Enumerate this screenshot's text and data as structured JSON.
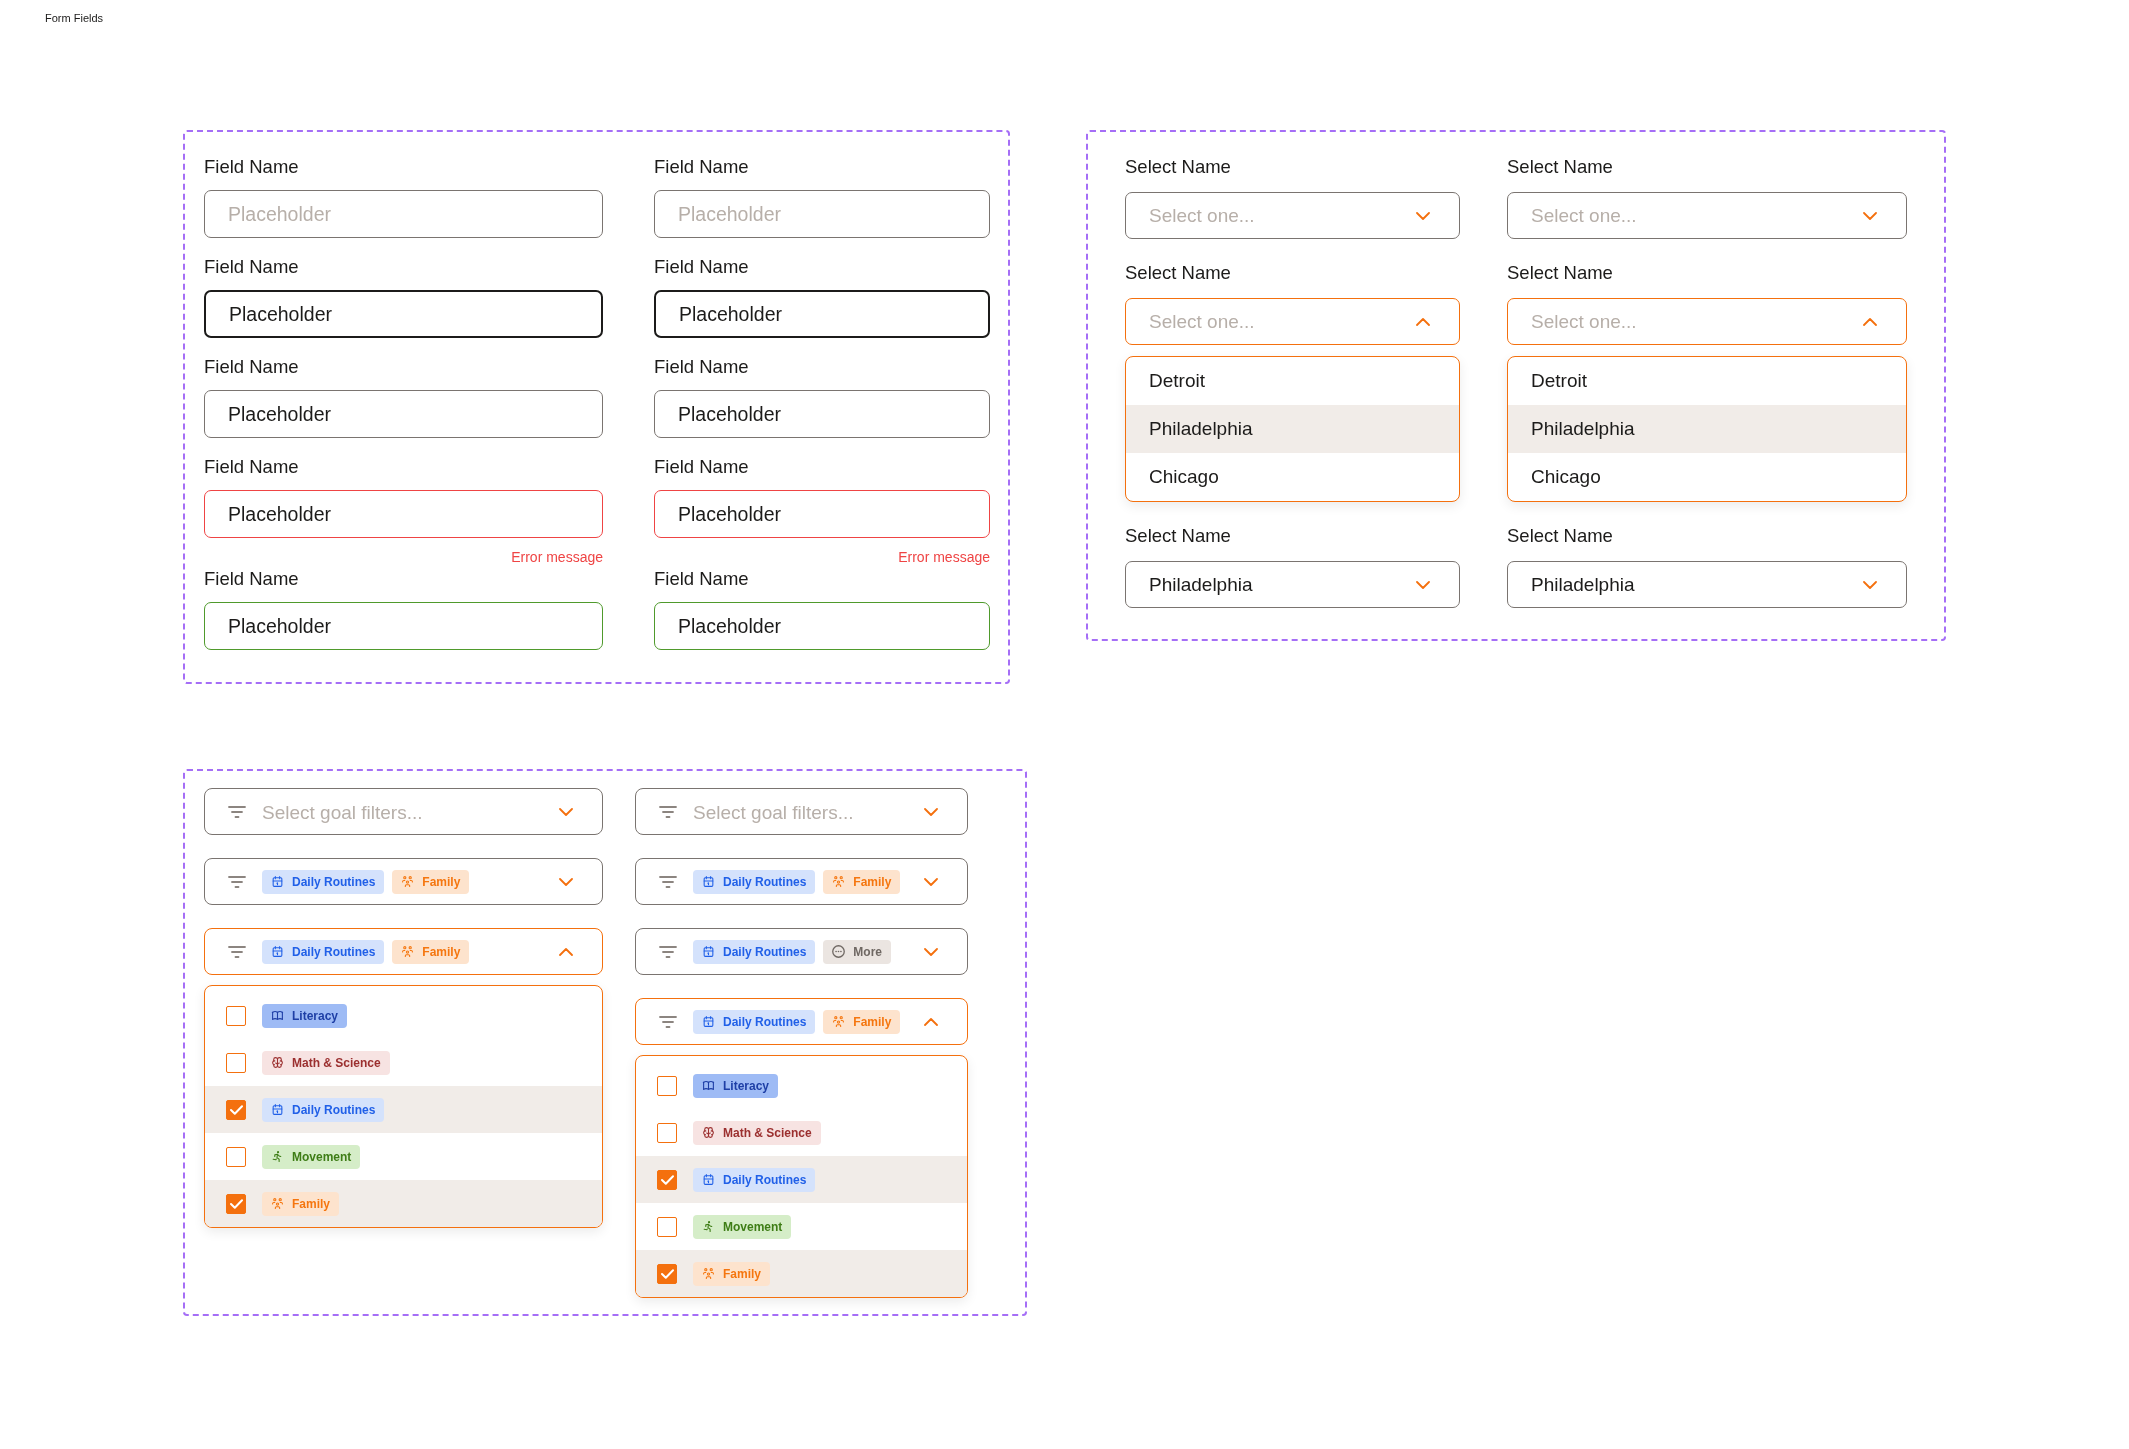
{
  "title": "Form Fields",
  "text_fields": {
    "columns": [
      {
        "fields": [
          {
            "label": "Field Name",
            "placeholder": "Placeholder",
            "focused": false,
            "invalid": false,
            "valid": false
          },
          {
            "label": "Field Name",
            "value": "Placeholder",
            "focused": true,
            "invalid": false,
            "valid": false
          },
          {
            "label": "Field Name",
            "value": "Placeholder",
            "focused": false,
            "invalid": false,
            "valid": false
          },
          {
            "label": "Field Name",
            "value": "Placeholder",
            "focused": false,
            "invalid": true,
            "valid": false,
            "error": "Error message"
          },
          {
            "label": "Field Name",
            "value": "Placeholder",
            "focused": false,
            "invalid": false,
            "valid": true
          }
        ]
      },
      {
        "fields": [
          {
            "label": "Field Name",
            "placeholder": "Placeholder",
            "focused": false,
            "invalid": false,
            "valid": false
          },
          {
            "label": "Field Name",
            "value": "Placeholder",
            "focused": true,
            "invalid": false,
            "valid": false
          },
          {
            "label": "Field Name",
            "value": "Placeholder",
            "focused": false,
            "invalid": false,
            "valid": false
          },
          {
            "label": "Field Name",
            "value": "Placeholder",
            "focused": false,
            "invalid": true,
            "valid": false,
            "error": "Error message"
          },
          {
            "label": "Field Name",
            "value": "Placeholder",
            "focused": false,
            "invalid": false,
            "valid": true
          }
        ]
      }
    ]
  },
  "selects": {
    "columns": [
      {
        "selects": [
          {
            "label": "Select Name",
            "placeholder": "Select one...",
            "expanded": false
          },
          {
            "label": "Select Name",
            "placeholder": "Select one...",
            "expanded": true,
            "options": [
              {
                "label": "Detroit",
                "selected": false
              },
              {
                "label": "Philadelphia",
                "selected": true
              },
              {
                "label": "Chicago",
                "selected": false
              }
            ]
          },
          {
            "label": "Select Name",
            "value": "Philadelphia",
            "expanded": false
          }
        ]
      },
      {
        "selects": [
          {
            "label": "Select Name",
            "placeholder": "Select one...",
            "expanded": false
          },
          {
            "label": "Select Name",
            "placeholder": "Select one...",
            "expanded": true,
            "options": [
              {
                "label": "Detroit",
                "selected": false
              },
              {
                "label": "Philadelphia",
                "selected": true
              },
              {
                "label": "Chicago",
                "selected": false
              }
            ]
          },
          {
            "label": "Select Name",
            "value": "Philadelphia",
            "expanded": false
          }
        ]
      }
    ]
  },
  "goal_filters": {
    "columns": [
      {
        "filters": [
          {
            "placeholder": "Select goal filters...",
            "expanded": false
          },
          {
            "tags": [
              {
                "kind": "routines",
                "label": "Daily Routines",
                "color": "#d4e2fc"
              },
              {
                "kind": "family",
                "label": "Family",
                "color": "#fde3cd"
              }
            ],
            "expanded": false
          },
          {
            "tags": [
              {
                "kind": "routines",
                "label": "Daily Routines",
                "color": "#d4e2fc"
              },
              {
                "kind": "family",
                "label": "Family",
                "color": "#fde3cd"
              }
            ],
            "expanded": true,
            "options": [
              {
                "kind": "literacy",
                "label": "Literacy",
                "color": "#9ebbf5",
                "checked": false
              },
              {
                "kind": "science",
                "label": "Math & Science",
                "color": "#f7e3e2",
                "checked": false
              },
              {
                "kind": "routines",
                "label": "Daily Routines",
                "color": "#d4e2fc",
                "checked": true
              },
              {
                "kind": "movement",
                "label": "Movement",
                "color": "#d5edc8",
                "checked": false
              },
              {
                "kind": "family",
                "label": "Family",
                "color": "#fde3cd",
                "checked": true
              }
            ]
          }
        ]
      },
      {
        "filters": [
          {
            "placeholder": "Select goal filters...",
            "expanded": false
          },
          {
            "tags": [
              {
                "kind": "routines",
                "label": "Daily Routines",
                "color": "#d4e2fc"
              },
              {
                "kind": "family",
                "label": "Family",
                "color": "#fde3cd"
              }
            ],
            "expanded": false
          },
          {
            "tags": [
              {
                "kind": "routines",
                "label": "Daily Routines",
                "color": "#d4e2fc"
              },
              {
                "kind": "more",
                "label": "More",
                "color": "#ebe5e1"
              }
            ],
            "expanded": false
          },
          {
            "tags": [
              {
                "kind": "routines",
                "label": "Daily Routines",
                "color": "#d4e2fc"
              },
              {
                "kind": "family",
                "label": "Family",
                "color": "#fde3cd"
              }
            ],
            "expanded": true,
            "options": [
              {
                "kind": "literacy",
                "label": "Literacy",
                "color": "#9ebbf5",
                "checked": false
              },
              {
                "kind": "science",
                "label": "Math & Science",
                "color": "#f7e3e2",
                "checked": false
              },
              {
                "kind": "routines",
                "label": "Daily Routines",
                "color": "#d4e2fc",
                "checked": true
              },
              {
                "kind": "movement",
                "label": "Movement",
                "color": "#d5edc8",
                "checked": false
              },
              {
                "kind": "family",
                "label": "Family",
                "color": "#fde3cd",
                "checked": true
              }
            ]
          }
        ]
      }
    ]
  }
}
